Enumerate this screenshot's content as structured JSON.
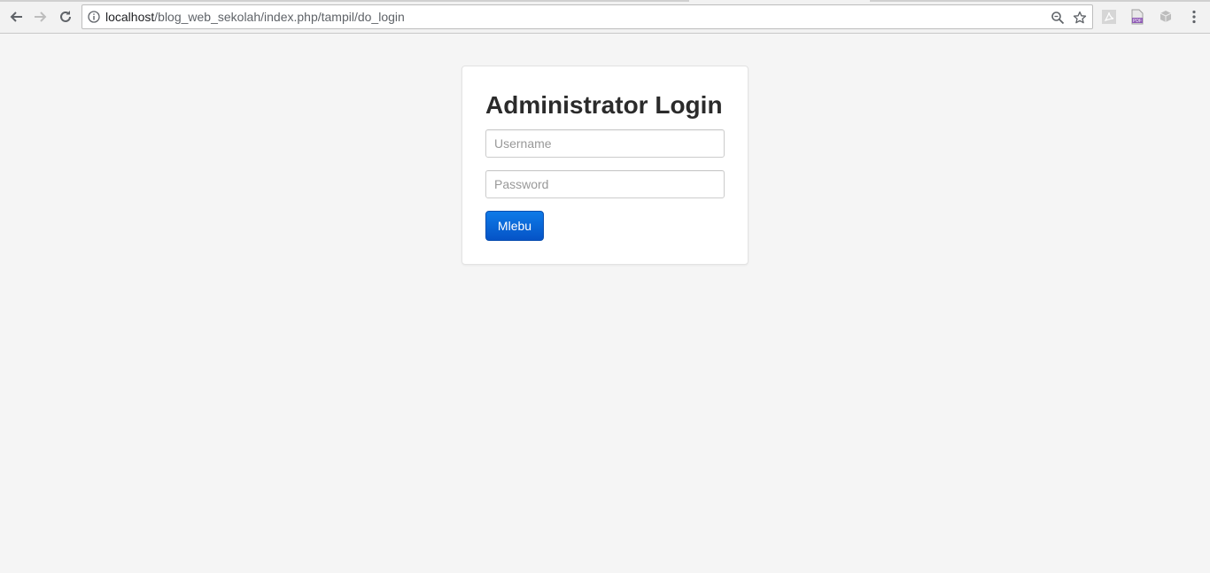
{
  "browser": {
    "url_host": "localhost",
    "url_path": "/blog_web_sekolah/index.php/tampil/do_login"
  },
  "login": {
    "title": "Administrator Login",
    "username_placeholder": "Username",
    "username_value": "",
    "password_placeholder": "Password",
    "password_value": "",
    "submit_label": "Mlebu"
  },
  "colors": {
    "page_background": "#f5f5f5",
    "button_primary": "#0a5fd8",
    "title_text": "#2b2b2b"
  },
  "icons": {
    "back": "back-arrow-icon",
    "forward": "forward-arrow-icon",
    "reload": "reload-icon",
    "site_info": "info-icon",
    "zoom": "zoom-icon",
    "bookmark": "star-icon",
    "extension_1": "pdf-extension-icon",
    "extension_2": "pdf-file-extension-icon",
    "extension_3": "cube-extension-icon",
    "menu": "kebab-menu-icon"
  }
}
